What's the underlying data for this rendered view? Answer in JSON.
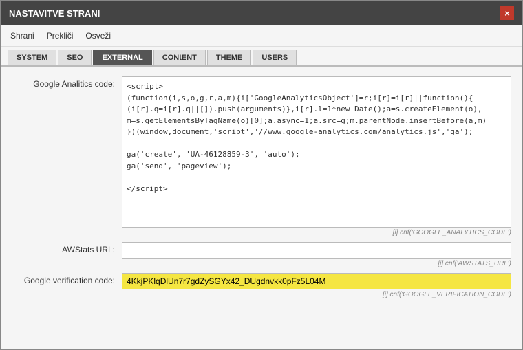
{
  "modal": {
    "title": "NASTAVITVE STRANI",
    "close_label": "×"
  },
  "toolbar": {
    "save_label": "Shrani",
    "cancel_label": "Prekliči",
    "refresh_label": "Osveži"
  },
  "tabs": [
    {
      "id": "system",
      "label": "SYSTEM",
      "active": false
    },
    {
      "id": "seo",
      "label": "SEO",
      "active": false
    },
    {
      "id": "external",
      "label": "EXTERNAL",
      "active": true
    },
    {
      "id": "content",
      "label": "CONtENT",
      "active": false
    },
    {
      "id": "theme",
      "label": "THEME",
      "active": false
    },
    {
      "id": "users",
      "label": "USERS",
      "active": false
    }
  ],
  "fields": {
    "analytics": {
      "label": "Google Analitics code:",
      "value": "<script>\n(function(i,s,o,g,r,a,m){i['GoogleAnalyticsObject']=r;i[r]=i[r]||function(){\n(i[r].q=i[r].q||[]).push(arguments)},i[r].l=1*new Date();a=s.createElement(o),\nm=s.getElementsByTagName(o)[0];a.async=1;a.src=g;m.parentNode.insertBefore(a,m)\n})(window,document,'script','//www.google-analytics.com/analytics.js','ga');\n\nga('create', 'UA-46128859-3', 'auto');\nga('send', 'pageview');\n\n</script>",
      "hint": "[i] cnf('GOOGLE_ANALYTICS_CODE')"
    },
    "awstats": {
      "label": "AWStats URL:",
      "value": "",
      "hint": "[i] cnf('AWSTATS_URL')"
    },
    "verification": {
      "label": "Google verification code:",
      "value": "4KkjPKlqDlUn7r7gdZySGYx42_DUgdnvkk0pFz5L04M",
      "hint": "[i] cnf('GOOGLE_VERIFICATION_CODE')"
    }
  }
}
